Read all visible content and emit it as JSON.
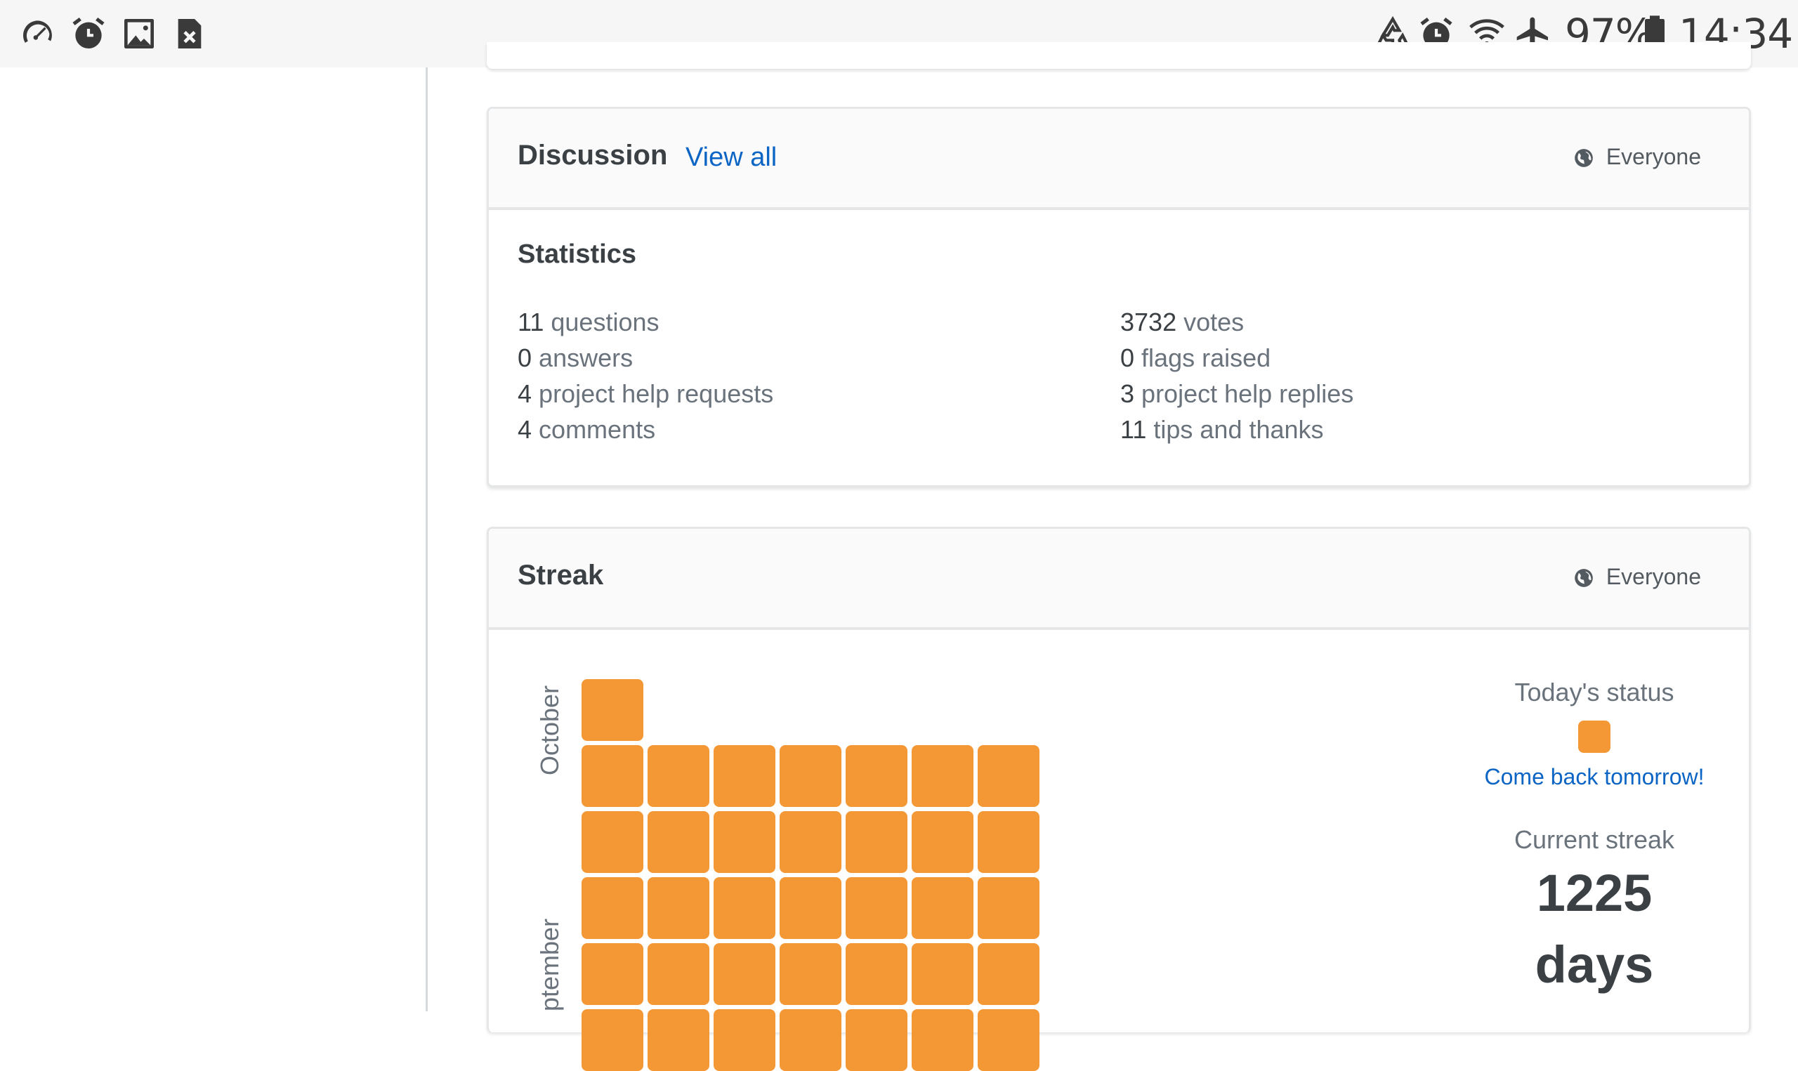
{
  "status_bar": {
    "left_icons": [
      "speedometer-icon",
      "alarm-icon",
      "image-icon",
      "file-close-icon"
    ],
    "right_icons": [
      "recycle-icon",
      "alarm-icon",
      "wifi-icon",
      "airplane-icon",
      "battery-icon"
    ],
    "battery": "97%",
    "time": "14:34"
  },
  "discussion": {
    "title": "Discussion",
    "view_all": "View all",
    "visibility": "Everyone",
    "stats_title": "Statistics",
    "left": [
      {
        "num": "11",
        "label": "questions"
      },
      {
        "num": "0",
        "label": "answers"
      },
      {
        "num": "4",
        "label": "project help requests"
      },
      {
        "num": "4",
        "label": "comments"
      }
    ],
    "right": [
      {
        "num": "3732",
        "label": "votes"
      },
      {
        "num": "0",
        "label": "flags raised"
      },
      {
        "num": "3",
        "label": "project help replies"
      },
      {
        "num": "11",
        "label": "tips and thanks"
      }
    ]
  },
  "streak": {
    "title": "Streak",
    "visibility": "Everyone",
    "months": [
      "October",
      "ptember"
    ],
    "todays_status_label": "Today's status",
    "come_back": "Come back tomorrow!",
    "current_streak_label": "Current streak",
    "current_streak_value": "1225",
    "current_streak_unit": "days",
    "cell_color": "#f49835"
  }
}
